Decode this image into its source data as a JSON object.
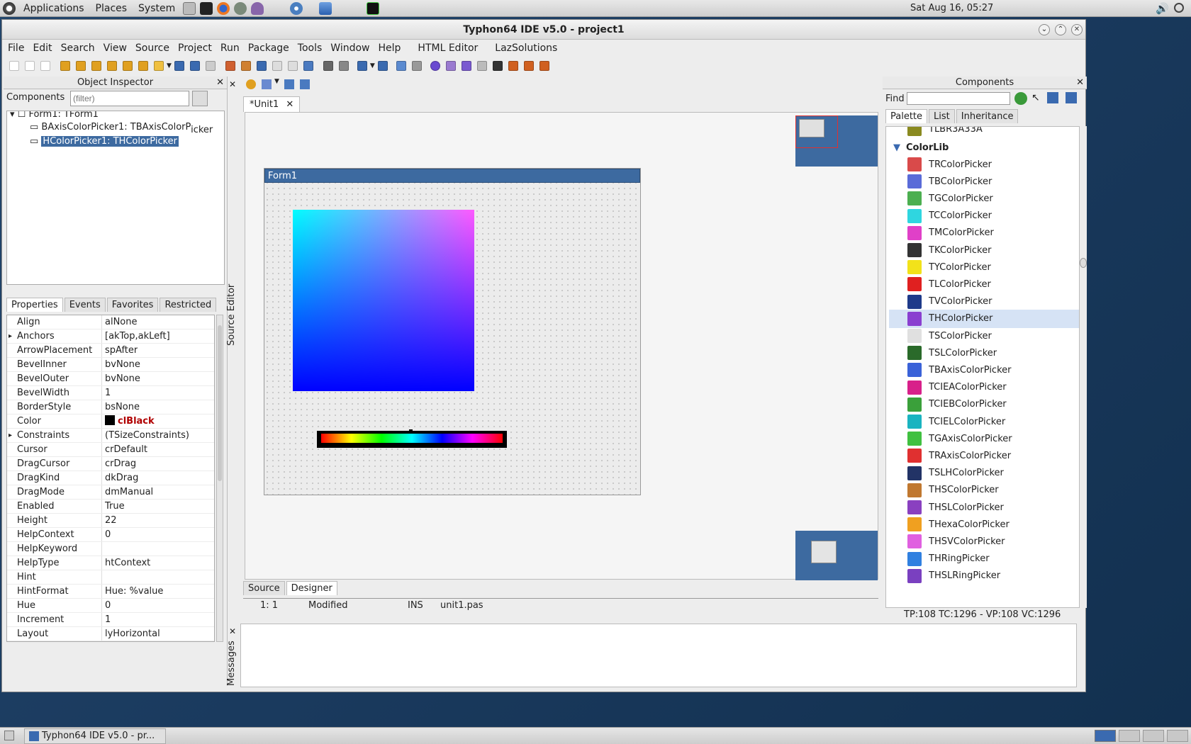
{
  "topbar": {
    "applications": "Applications",
    "places": "Places",
    "system": "System",
    "clock": "Sat Aug 16, 05:27"
  },
  "window": {
    "title": "Typhon64 IDE v5.0 - project1"
  },
  "menu": [
    "File",
    "Edit",
    "Search",
    "View",
    "Source",
    "Project",
    "Run",
    "Package",
    "Tools",
    "Window",
    "Help",
    "HTML Editor",
    "LazSolutions"
  ],
  "inspector": {
    "title": "Object Inspector",
    "components_label": "Components",
    "filter_placeholder": "(filter)",
    "tree": [
      {
        "label": "Form1: TForm1"
      },
      {
        "label": "BAxisColorPicker1: TBAxisColorP",
        "overflow": "icker"
      },
      {
        "label": "HColorPicker1: THColorPicker"
      }
    ],
    "tabs": [
      "Properties",
      "Events",
      "Favorites",
      "Restricted"
    ],
    "properties": [
      {
        "name": "Align",
        "value": "alNone"
      },
      {
        "name": "Anchors",
        "value": "[akTop,akLeft]",
        "expand": true
      },
      {
        "name": "ArrowPlacement",
        "value": "spAfter"
      },
      {
        "name": "BevelInner",
        "value": "bvNone"
      },
      {
        "name": "BevelOuter",
        "value": "bvNone"
      },
      {
        "name": "BevelWidth",
        "value": "1"
      },
      {
        "name": "BorderStyle",
        "value": "bsNone"
      },
      {
        "name": "Color",
        "value": "clBlack",
        "swatch": "#000000"
      },
      {
        "name": "Constraints",
        "value": "(TSizeConstraints)",
        "expand": true
      },
      {
        "name": "Cursor",
        "value": "crDefault"
      },
      {
        "name": "DragCursor",
        "value": "crDrag"
      },
      {
        "name": "DragKind",
        "value": "dkDrag"
      },
      {
        "name": "DragMode",
        "value": "dmManual"
      },
      {
        "name": "Enabled",
        "value": "True"
      },
      {
        "name": "Height",
        "value": "22"
      },
      {
        "name": "HelpContext",
        "value": "0"
      },
      {
        "name": "HelpKeyword",
        "value": ""
      },
      {
        "name": "HelpType",
        "value": "htContext"
      },
      {
        "name": "Hint",
        "value": ""
      },
      {
        "name": "HintFormat",
        "value": "Hue: %value"
      },
      {
        "name": "Hue",
        "value": "0"
      },
      {
        "name": "Increment",
        "value": "1"
      },
      {
        "name": "Layout",
        "value": "lyHorizontal"
      }
    ]
  },
  "editor": {
    "tab": "*Unit1",
    "form_title": "Form1",
    "source_editor_label": "Source Editor",
    "bottom_tabs": [
      "Source",
      "Designer"
    ],
    "status": {
      "pos": "1:  1",
      "state": "Modified",
      "mode": "INS",
      "file": "unit1.pas"
    },
    "messages_label": "Messages"
  },
  "components": {
    "title": "Components",
    "find_label": "Find",
    "tabs": [
      "Palette",
      "List",
      "Inheritance"
    ],
    "cut_item": "TLBR3A33A",
    "group": "ColorLib",
    "items": [
      {
        "label": "TRColorPicker",
        "c": "#d94a4a"
      },
      {
        "label": "TBColorPicker",
        "c": "#5a6bd8"
      },
      {
        "label": "TGColorPicker",
        "c": "#4caf50"
      },
      {
        "label": "TCColorPicker",
        "c": "#2fd6e0"
      },
      {
        "label": "TMColorPicker",
        "c": "#e040c8"
      },
      {
        "label": "TKColorPicker",
        "c": "#333333"
      },
      {
        "label": "TYColorPicker",
        "c": "#f2e21a"
      },
      {
        "label": "TLColorPicker",
        "c": "#e02020"
      },
      {
        "label": "TVColorPicker",
        "c": "#1e3a8a"
      },
      {
        "label": "THColorPicker",
        "c": "#8a3fd0",
        "selected": true
      },
      {
        "label": "TSColorPicker",
        "c": "#e0e0e0"
      },
      {
        "label": "TSLColorPicker",
        "c": "#2a6a2a"
      },
      {
        "label": "TBAxisColorPicker",
        "c": "#3a62d8"
      },
      {
        "label": "TCIEAColorPicker",
        "c": "#d8208a"
      },
      {
        "label": "TCIEBColorPicker",
        "c": "#3aa03a"
      },
      {
        "label": "TCIELColorPicker",
        "c": "#1ab4c0"
      },
      {
        "label": "TGAxisColorPicker",
        "c": "#40c040"
      },
      {
        "label": "TRAxisColorPicker",
        "c": "#e03030"
      },
      {
        "label": "TSLHColorPicker",
        "c": "#223366"
      },
      {
        "label": "THSColorPicker",
        "c": "#c07830"
      },
      {
        "label": "THSLColorPicker",
        "c": "#8a40c0"
      },
      {
        "label": "THexaColorPicker",
        "c": "#f0a020"
      },
      {
        "label": "THSVColorPicker",
        "c": "#e060e0"
      },
      {
        "label": "THRingPicker",
        "c": "#3080e0"
      }
    ],
    "cut_bottom": "THSLRingPicker",
    "status": "TP:108 TC:1296 - VP:108 VC:1296"
  },
  "taskbar": {
    "item": "Typhon64 IDE v5.0 - pr..."
  }
}
